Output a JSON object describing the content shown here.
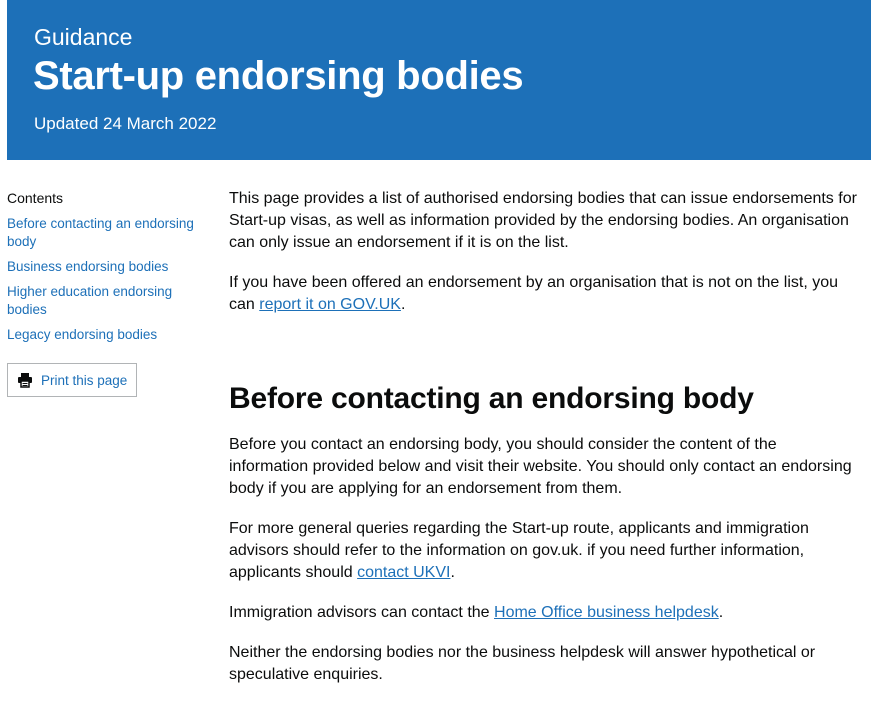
{
  "header": {
    "kicker": "Guidance",
    "title": "Start-up endorsing bodies",
    "updated": "Updated 24 March 2022",
    "background_color": "#1d70b8"
  },
  "sidebar": {
    "contents_heading": "Contents",
    "items": [
      {
        "label": "Before contacting an endorsing body"
      },
      {
        "label": "Business endorsing bodies"
      },
      {
        "label": "Higher education endorsing bodies"
      },
      {
        "label": "Legacy endorsing bodies"
      }
    ],
    "print_label": "Print this page",
    "print_icon": "printer-icon"
  },
  "intro": {
    "p1": "This page provides a list of authorised endorsing bodies that can issue endorsements for Start-up visas, as well as information provided by the endorsing bodies. An organisation can only issue an endorsement if it is on the list.",
    "p2_before": "If you have been offered an endorsement by an organisation that is not on the list, you can ",
    "p2_link": "report it on GOV.UK",
    "p2_after": "."
  },
  "section": {
    "heading": "Before contacting an endorsing body",
    "p1": "Before you contact an endorsing body, you should consider the content of the information provided below and visit their website. You should only contact an endorsing body if you are applying for an endorsement from them.",
    "p2_before": "For more general queries regarding the Start-up route, applicants and immigration advisors should refer to the information on gov.uk. if you need further information, applicants should ",
    "p2_link": "contact UKVI",
    "p2_after": ".",
    "p3_before": "Immigration advisors can contact the ",
    "p3_link": "Home Office business helpdesk",
    "p3_after": ".",
    "p4": "Neither the endorsing bodies nor the business helpdesk will answer hypothetical or speculative enquiries."
  },
  "colors": {
    "link": "#1d70b8",
    "text": "#0b0c0c"
  }
}
